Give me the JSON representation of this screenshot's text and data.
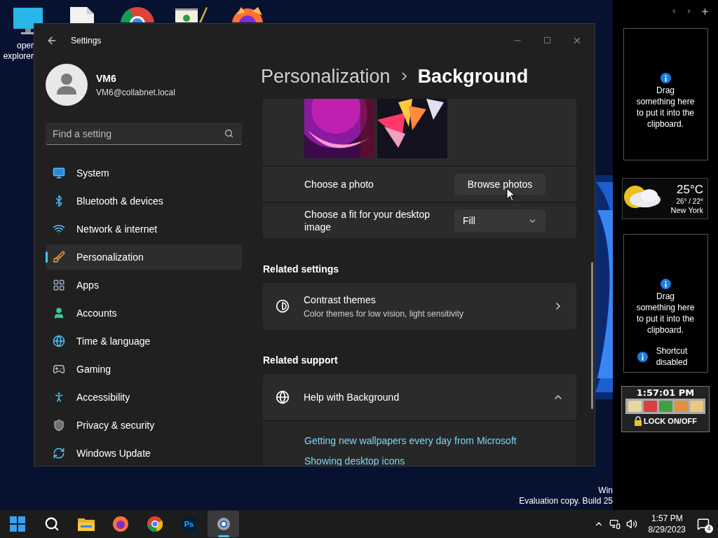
{
  "desktop": {
    "icons": [
      {
        "kind": "monitor",
        "label_lines": [
          "oper",
          "explorer"
        ]
      },
      {
        "kind": "document"
      },
      {
        "kind": "chrome"
      },
      {
        "kind": "notepad"
      },
      {
        "kind": "firefox"
      }
    ],
    "watermark": [
      "Win",
      "Evaluation copy. Build 25"
    ]
  },
  "window": {
    "title": "Settings",
    "account": {
      "name": "VM6",
      "email": "VM6@collabnet.local"
    },
    "search": {
      "placeholder": "Find a setting"
    },
    "nav": [
      {
        "label": "System",
        "selected": false
      },
      {
        "label": "Bluetooth & devices",
        "selected": false
      },
      {
        "label": "Network & internet",
        "selected": false
      },
      {
        "label": "Personalization",
        "selected": true
      },
      {
        "label": "Apps",
        "selected": false
      },
      {
        "label": "Accounts",
        "selected": false
      },
      {
        "label": "Time & language",
        "selected": false
      },
      {
        "label": "Gaming",
        "selected": false
      },
      {
        "label": "Accessibility",
        "selected": false
      },
      {
        "label": "Privacy & security",
        "selected": false
      },
      {
        "label": "Windows Update",
        "selected": false
      }
    ],
    "breadcrumb": [
      "Personalization",
      "Background"
    ],
    "background_rows": [
      {
        "kind": "button",
        "label": "Choose a photo",
        "control": "Browse photos"
      },
      {
        "kind": "dropdown",
        "label": "Choose a fit for your desktop image",
        "control": "Fill"
      }
    ],
    "related_settings": {
      "heading": "Related settings",
      "items": [
        {
          "title": "Contrast themes",
          "subtitle": "Color themes for low vision, light sensitivity"
        }
      ]
    },
    "related_support": {
      "heading": "Related support",
      "items": [
        {
          "title": "Help with Background",
          "expanded": true,
          "links": [
            "Getting new wallpapers every day from Microsoft",
            "Showing desktop icons"
          ]
        }
      ]
    }
  },
  "gadgets": [
    {
      "kind": "clipboard",
      "message": "Drag something here to put it into the clipboard."
    },
    {
      "kind": "weather",
      "temperature": "25°C",
      "range": "26° / 22°",
      "city": "New York"
    },
    {
      "kind": "clipboard",
      "message": "Drag something here to put it into the clipboard.",
      "note": "Shortcut disabled"
    },
    {
      "kind": "clock",
      "time": "1:57:01 PM",
      "lock_label": "LOCK ON/OFF"
    }
  ],
  "taskbar": {
    "apps": [
      {
        "kind": "start",
        "selected": false
      },
      {
        "kind": "search",
        "selected": false
      },
      {
        "kind": "folder",
        "selected": false
      },
      {
        "kind": "firefox",
        "selected": false
      },
      {
        "kind": "chrome",
        "selected": false
      },
      {
        "kind": "photoshop",
        "text": "Ps",
        "selected": false
      },
      {
        "kind": "settings",
        "selected": true
      }
    ],
    "time": "1:57 PM",
    "date": "8/29/2023",
    "notifications": "4"
  }
}
